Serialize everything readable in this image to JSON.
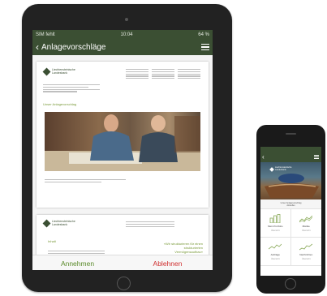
{
  "tablet": {
    "status": {
      "carrier": "SIM fehlt",
      "time": "10:04",
      "battery": "64 %"
    },
    "title": "Anlagevorschläge",
    "document": {
      "company": "Liechtensteinische Landesbank",
      "section_heading": "Unser Anlagevorschlag",
      "page2_heading": "Inhalt",
      "page2_quote": "«Wir strukturieren für einen strukturierten Vermögensaufbau»"
    },
    "actions": {
      "accept": "Annehmen",
      "reject": "Ablehnen"
    }
  },
  "phone": {
    "company": "Liechtensteinische Landesbank",
    "caption_line1": "Unser Anlagevorschlag",
    "caption_line2": "Aktuelles",
    "tiles": [
      {
        "label": "Mein Portfolio",
        "sub": "Übersicht"
      },
      {
        "label": "Märkte",
        "sub": "Übersicht"
      },
      {
        "label": "Aufträge",
        "sub": "Übersicht"
      },
      {
        "label": "Nachrichten",
        "sub": "Übersicht"
      }
    ]
  },
  "colors": {
    "brand_green": "#3b4f33",
    "accept": "#5a8a2a",
    "reject": "#d03030"
  },
  "icons": [
    "back-chevron-icon",
    "menu-icon",
    "bank-logo-icon",
    "bar-chart-icon",
    "chart-line-icon"
  ]
}
